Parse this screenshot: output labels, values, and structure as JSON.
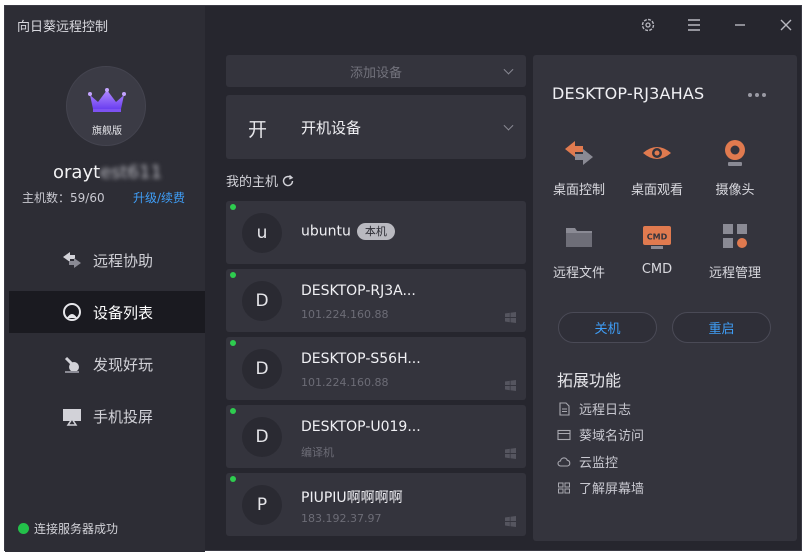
{
  "app": {
    "title": "向日葵远程控制"
  },
  "profile": {
    "edition": "旗舰版",
    "username_visible": "orayt",
    "username_masked": "est611",
    "host_count_label": "主机数：",
    "host_count_value": "59/60",
    "upgrade_label": "升级/续费"
  },
  "nav": [
    {
      "label": "远程协助",
      "icon": "remote-assist-icon"
    },
    {
      "label": "设备列表",
      "icon": "device-list-icon",
      "active": true
    },
    {
      "label": "发现好玩",
      "icon": "discover-icon"
    },
    {
      "label": "手机投屏",
      "icon": "screen-cast-icon"
    }
  ],
  "status": {
    "text": "连接服务器成功",
    "color": "#23c04a"
  },
  "device_list": {
    "add_device_placeholder": "添加设备",
    "boot_device": {
      "char": "开",
      "label": "开机设备"
    },
    "my_hosts_label": "我的主机",
    "devices": [
      {
        "initial": "u",
        "name": "ubuntu",
        "badge": "本机",
        "sub": "",
        "online": true
      },
      {
        "initial": "D",
        "name": "DESKTOP-RJ3A...",
        "sub": "101.224.160.88",
        "os": "windows-icon",
        "online": true
      },
      {
        "initial": "D",
        "name": "DESKTOP-S56H...",
        "sub": "101.224.160.88",
        "os": "windows-icon",
        "online": true
      },
      {
        "initial": "D",
        "name": "DESKTOP-U019...",
        "sub": "编译机",
        "os": "windows-icon",
        "online": true
      },
      {
        "initial": "P",
        "name": "PIUPIU啊啊啊啊",
        "sub": "183.192.37.97",
        "os": "windows-icon",
        "online": true
      }
    ]
  },
  "detail": {
    "title": "DESKTOP-RJ3AHAS",
    "actions": [
      {
        "label": "桌面控制",
        "icon": "desktop-control-icon"
      },
      {
        "label": "桌面观看",
        "icon": "desktop-view-icon"
      },
      {
        "label": "摄像头",
        "icon": "camera-icon"
      },
      {
        "label": "远程文件",
        "icon": "remote-file-icon"
      },
      {
        "label": "CMD",
        "icon": "cmd-icon",
        "icon_text": "CMD"
      },
      {
        "label": "远程管理",
        "icon": "remote-manage-icon"
      }
    ],
    "shutdown_label": "关机",
    "restart_label": "重启",
    "extensions_title": "拓展功能",
    "extensions": [
      {
        "label": "远程日志",
        "icon": "log-icon"
      },
      {
        "label": "葵域名访问",
        "icon": "domain-icon"
      },
      {
        "label": "云监控",
        "icon": "cloud-icon"
      },
      {
        "label": "了解屏幕墙",
        "icon": "screen-wall-icon"
      }
    ]
  },
  "colors": {
    "accent": "#3f9ef7",
    "online": "#2ecc4f",
    "cmd": "#e07a4f"
  }
}
